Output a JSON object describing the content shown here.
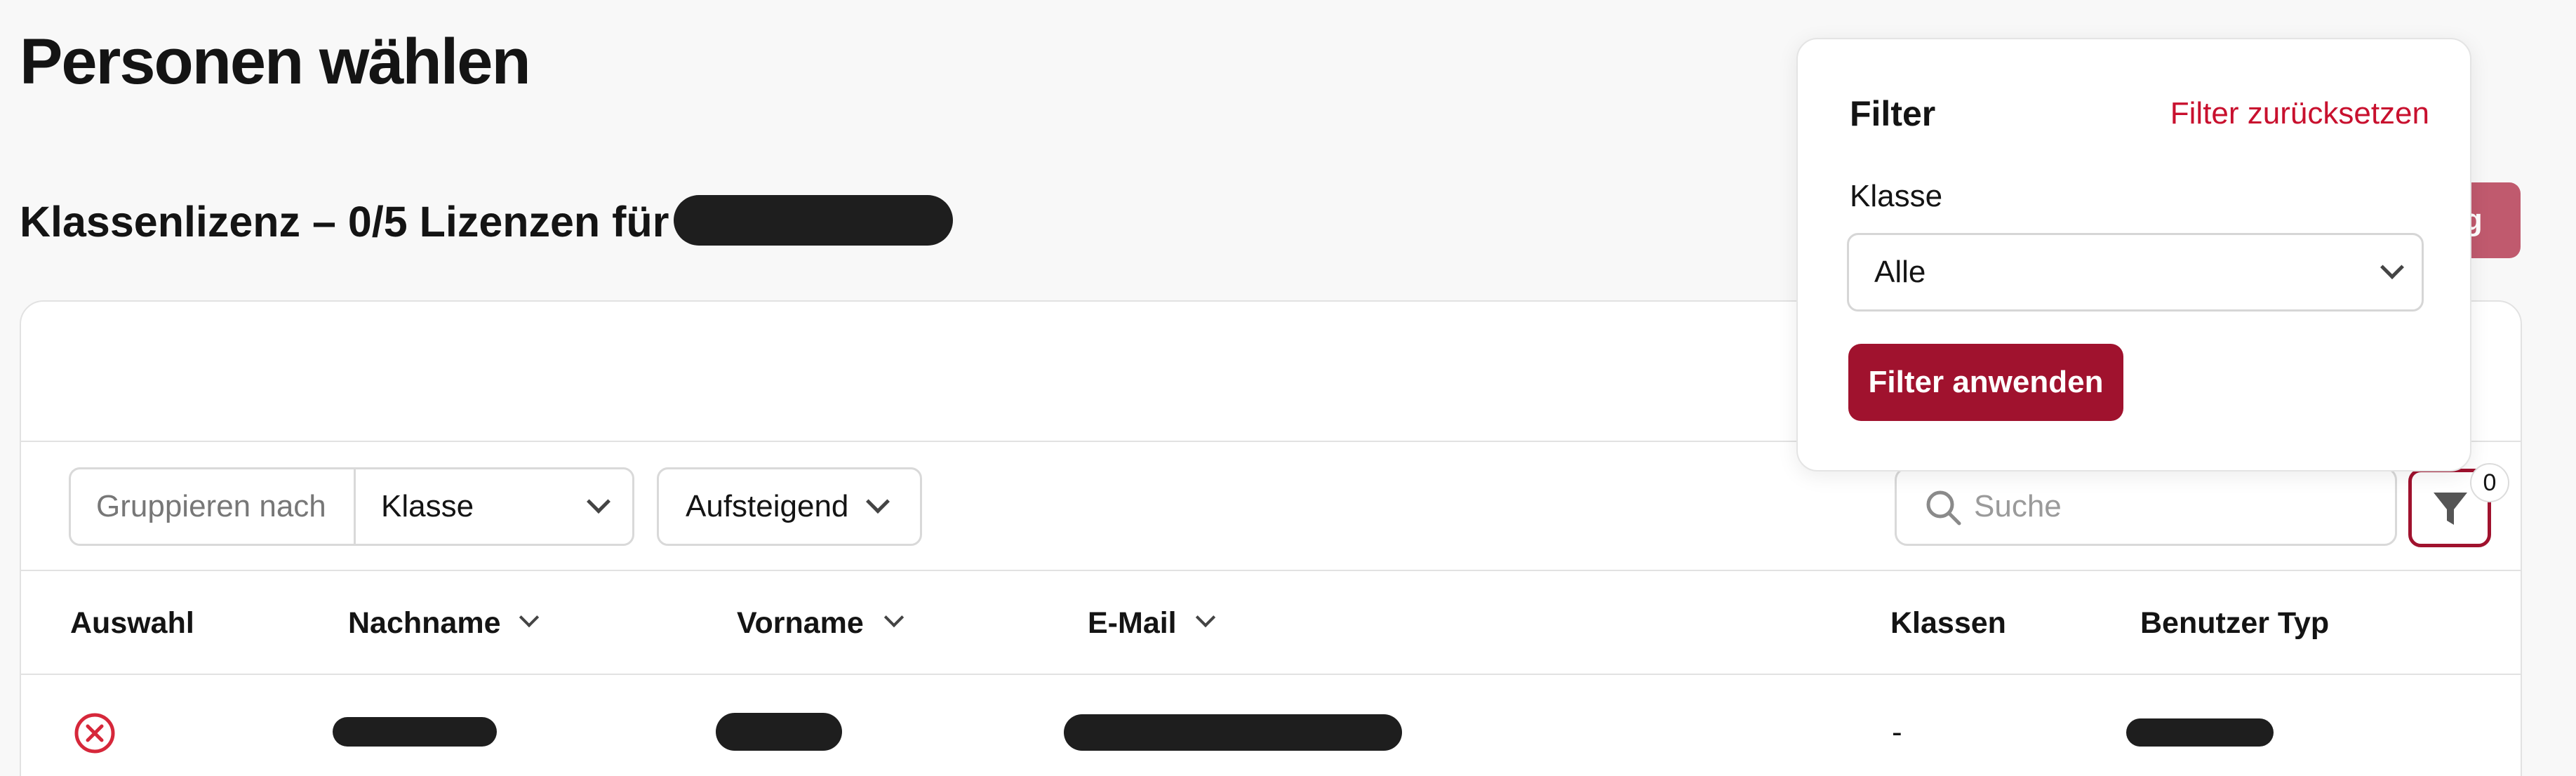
{
  "page": {
    "title": "Personen wählen",
    "section_title": "Klassenlizenz – 0/5 Lizenzen für",
    "primary_action_visible_text": "ng"
  },
  "toolbar": {
    "group_by_label": "Gruppieren nach",
    "group_by_value": "Klasse",
    "sort_value": "Aufsteigend",
    "search_placeholder": "Suche",
    "filter_count": "0"
  },
  "table": {
    "headers": [
      "Auswahl",
      "Nachname",
      "Vorname",
      "E-Mail",
      "Klassen",
      "Benutzer Typ"
    ],
    "rows": [
      {
        "klassen": "-"
      }
    ]
  },
  "filter_popover": {
    "title": "Filter",
    "reset_label": "Filter zurücksetzen",
    "class_label": "Klasse",
    "class_value": "Alle",
    "apply_label": "Filter anwenden"
  },
  "colors": {
    "brand": "#a0122e",
    "reset_link": "#c8102e",
    "deselect_icon": "#d6273a"
  },
  "icons": [
    "chevron-down-icon",
    "search-icon",
    "filter-funnel-icon",
    "deselect-x-circle-icon"
  ]
}
